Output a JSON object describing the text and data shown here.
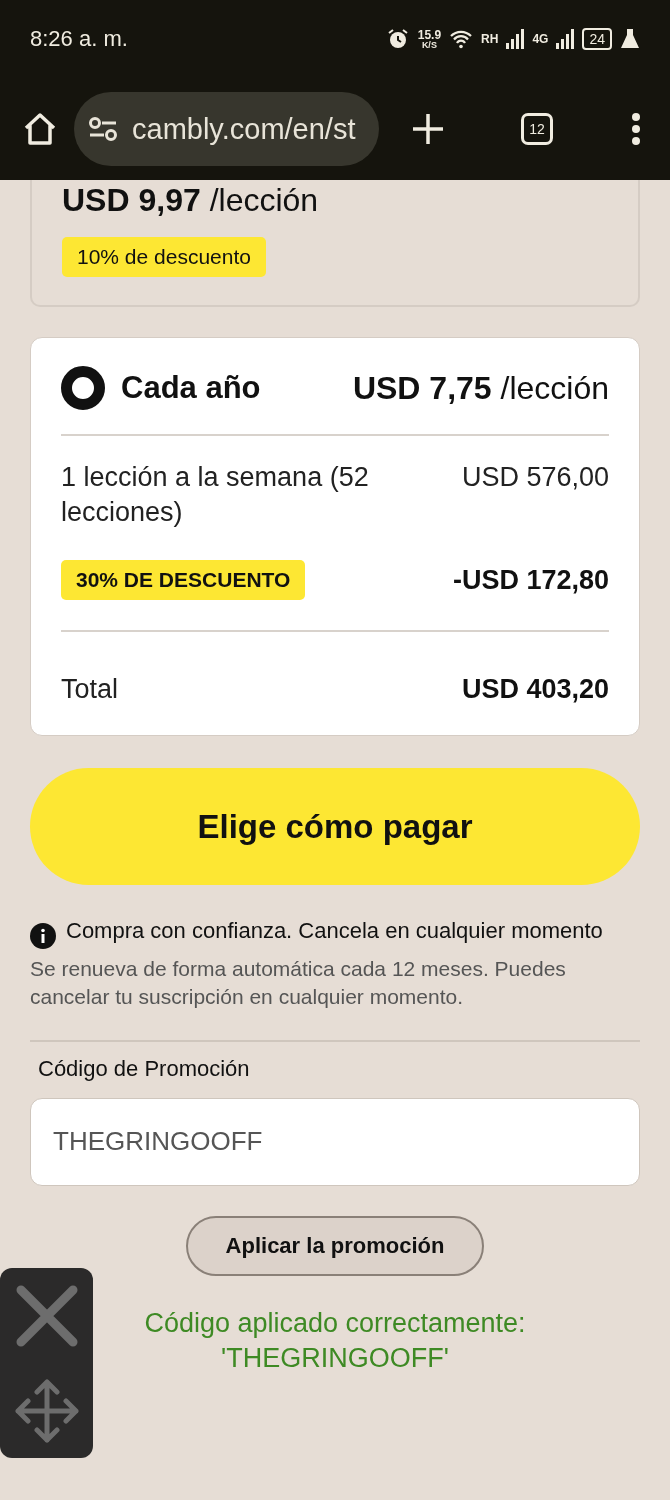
{
  "status_bar": {
    "time": "8:26 a. m.",
    "speed": "15.9",
    "speed_unit": "K/S",
    "network_1": "RH",
    "network_2": "4G",
    "battery": "24"
  },
  "browser": {
    "url": "cambly.com/en/st",
    "tab_count": "12"
  },
  "previous_plan": {
    "price": "USD 9,97",
    "unit": "/lección",
    "badge": "10% de descuento"
  },
  "plan": {
    "selected": true,
    "name": "Cada año",
    "price": "USD 7,75",
    "unit": "/lección",
    "line_label": "1 lección a la semana (52 lecciones)",
    "line_value": "USD 576,00",
    "discount_badge": "30% DE DESCUENTO",
    "discount_value": "-USD 172,80",
    "total_label": "Total",
    "total_value": "USD 403,20"
  },
  "pay_button": "Elige cómo pagar",
  "confidence": "Compra con confianza. Cancela en cualquier momento",
  "renewal": "Se renueva de forma automática cada 12 meses. Puedes cancelar tu suscripción en cualquier momento.",
  "promo": {
    "label": "Código de Promoción",
    "value": "THEGRINGOOFF",
    "button": "Aplicar la promoción",
    "success": "Código aplicado correctamente: 'THEGRINGOOFF'"
  }
}
